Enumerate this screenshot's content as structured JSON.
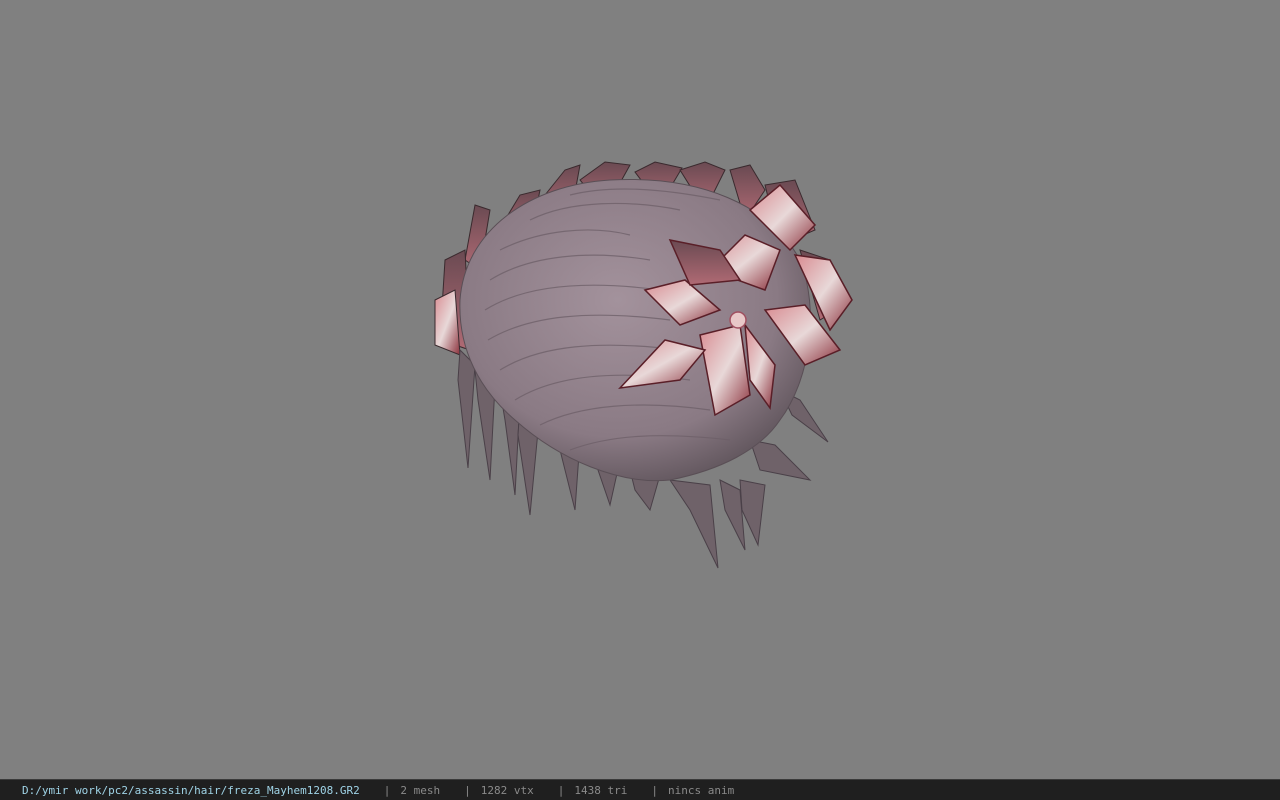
{
  "status_bar": {
    "file_path": "D:/ymir work/pc2/assassin/hair/freza_Mayhem1208.GR2",
    "separator": "|",
    "mesh_count": "2 mesh",
    "vertex_count": "1282 vtx",
    "triangle_count": "1438 tri",
    "animation": "nincs anim"
  },
  "colors": {
    "background": "#808080",
    "status_bar_bg": "#1f1f1f",
    "path_text": "#9fd3e6",
    "stat_text": "#8a8a8a",
    "hair": "#8f7f88",
    "flower_petal": "#b0606a"
  },
  "viewport": {
    "model_name": "3d-hair-model"
  }
}
